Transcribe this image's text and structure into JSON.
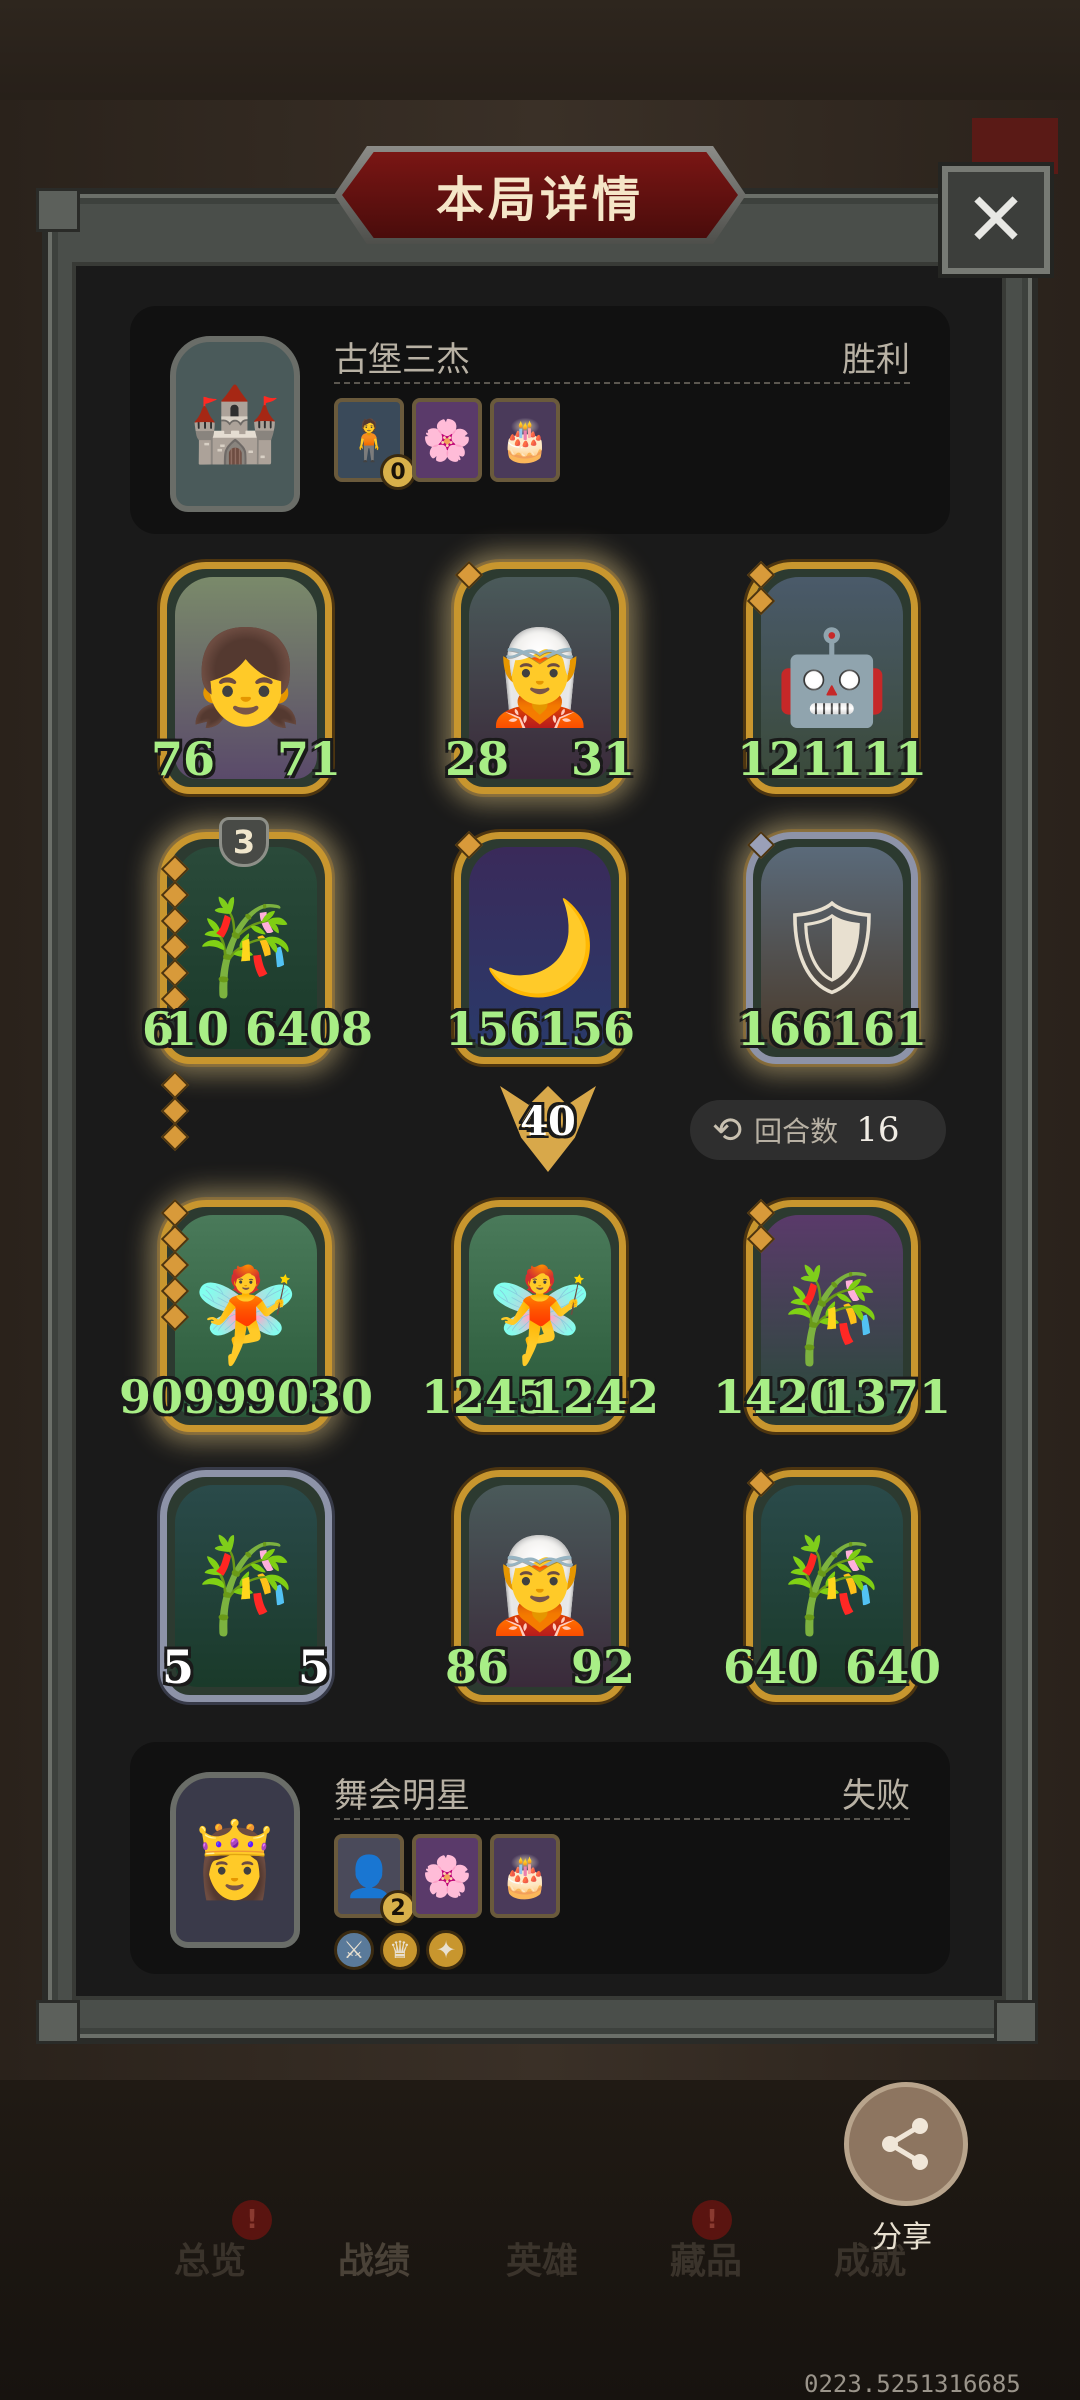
{
  "title": "本局详情",
  "close_icon": "close-icon",
  "top_player": {
    "name": "古堡三杰",
    "result": "胜利",
    "avatar_icon": "castle-trio-avatar-icon",
    "item_badge": "0"
  },
  "bottom_player": {
    "name": "舞会明星",
    "result": "失败",
    "avatar_icon": "ball-star-avatar-icon",
    "item_badge": "2"
  },
  "top_board": [
    {
      "atk": "76",
      "hp": "71"
    },
    {
      "atk": "28",
      "hp": "31"
    },
    {
      "atk": "121",
      "hp": "111"
    },
    {
      "atk": "6",
      "hp": "10 6408",
      "level": "3"
    },
    {
      "atk": "156",
      "hp": "156"
    },
    {
      "atk": "166",
      "hp": "161"
    }
  ],
  "center_value": "40",
  "turns": {
    "label": "回合数",
    "value": "16"
  },
  "bottom_board": [
    {
      "atk": "9099",
      "hp": "9030"
    },
    {
      "atk": "1245",
      "hp": "1242"
    },
    {
      "atk": "1420",
      "hp": "1371"
    },
    {
      "atk": "5",
      "hp": "5"
    },
    {
      "atk": "86",
      "hp": "92"
    },
    {
      "atk": "640",
      "hp": "640"
    }
  ],
  "nav": {
    "tabs": [
      "总览",
      "战绩",
      "英雄",
      "藏品",
      "成就"
    ],
    "active": "战绩"
  },
  "share": {
    "label": "分享"
  },
  "version": "0223.5251316685"
}
